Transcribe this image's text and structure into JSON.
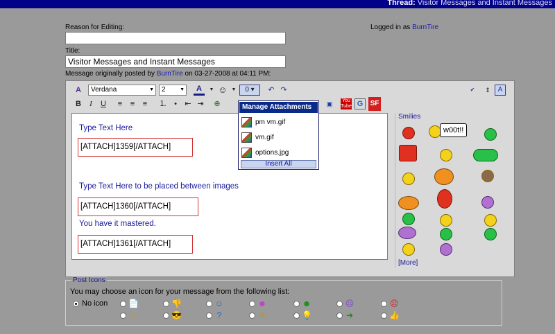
{
  "thread_bar": {
    "label": "Thread:",
    "title": "Visitor Messages and Instant Messages"
  },
  "form": {
    "reason_label": "Reason for Editing:",
    "reason_value": "",
    "logged_in_prefix": "Logged in as",
    "logged_in_user": "BurnTire",
    "title_label": "Title:",
    "title_value": "Visitor Messages and Instant Messages",
    "posted_by_prefix": "Message originally posted by",
    "posted_by_user": "BurnTire",
    "posted_on": "on 03-27-2008 at 04:11 PM:"
  },
  "toolbar": {
    "font": "Verdana",
    "size": "2",
    "tooltips_row1": [
      "switch-mode",
      "font",
      "size",
      "text-color",
      "smilies",
      "attachments",
      "undo",
      "redo"
    ],
    "right_icons": [
      "spell-check-icon",
      "resize-icon",
      "preview-icon"
    ]
  },
  "content": {
    "line1": "Type Text Here",
    "attach1": "[ATTACH]1359[/ATTACH]",
    "line2": "Type Text Here to be placed between images",
    "attach2": "[ATTACH]1360[/ATTACH]",
    "line3": "You have it mastered.",
    "attach3": "[ATTACH]1361[/ATTACH]"
  },
  "attachments_popup": {
    "title": "Manage Attachments",
    "items": [
      "pm vm.gif",
      "vm.gif",
      "options.jpg"
    ],
    "insert_all": "Insert All"
  },
  "smilies": {
    "title": "Smilies",
    "woot_text": "w00t!!",
    "more": "[More]"
  },
  "post_icons": {
    "legend": "Post Icons",
    "description": "You may choose an icon for your message from the following list:",
    "no_icon_label": "No icon"
  }
}
